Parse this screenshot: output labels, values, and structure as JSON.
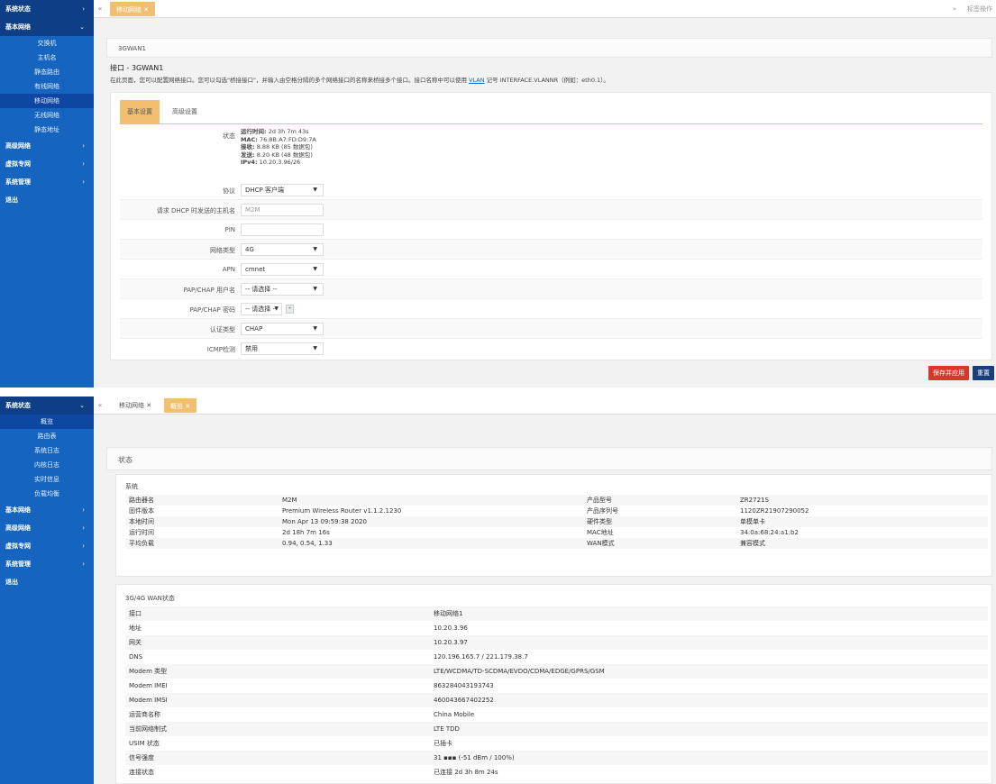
{
  "screen1": {
    "sidebar": {
      "groups": [
        "系统状态",
        "基本网络",
        "高级网络",
        "虚拟专网",
        "系统管理",
        "退出"
      ],
      "sub_items": [
        "交换机",
        "主机名",
        "静态路由",
        "有线网络",
        "移动网络",
        "无线网络",
        "静态地址"
      ]
    },
    "tabs": {
      "nav_left": "«",
      "active_tab": "移动网络",
      "nav_right": "»",
      "tab_ops": "标签操作"
    },
    "header": {
      "name": "3GWAN1",
      "title": "接口 - 3GWAN1",
      "desc_pre": "在此页面，您可以配置网络接口。您可以勾选\"桥接接口\"，并输入由空格分隔的多个网络接口的名称来桥接多个接口。接口名称中可以使用 ",
      "desc_link": "VLAN",
      "desc_post": " 记号 INTERFACE.VLANNR（例如：eth0.1）。"
    },
    "subtabs": [
      "基本设置",
      "高级设置"
    ],
    "status": {
      "label": "状态",
      "uptime_label": "运行时间:",
      "uptime": "2d 3h 7m 43s",
      "mac_label": "MAC:",
      "mac": "76:8B:A7:FD:D9:7A",
      "rx_label": "接收:",
      "rx": "8.88 KB (85 数据包)",
      "tx_label": "发送:",
      "tx": "8.20 KB (48 数据包)",
      "ipv4_label": "IPv4:",
      "ipv4": "10.20.3.96/26"
    },
    "fields": {
      "protocol": {
        "label": "协议",
        "value": "DHCP 客户端"
      },
      "hostname": {
        "label": "请求 DHCP 时发送的主机名",
        "placeholder": "M2M"
      },
      "pin": {
        "label": "PIN",
        "value": ""
      },
      "nettype": {
        "label": "网络类型",
        "value": "4G"
      },
      "apn": {
        "label": "APN",
        "value": "cmnet"
      },
      "user": {
        "label": "PAP/CHAP 用户名",
        "value": "-- 请选择 --"
      },
      "pass": {
        "label": "PAP/CHAP 密码",
        "value": "-- 请选择 --"
      },
      "auth": {
        "label": "认证类型",
        "value": "CHAP"
      },
      "icmp": {
        "label": "ICMP检测",
        "value": "禁用"
      }
    },
    "buttons": {
      "save": "保存并应用",
      "reset": "重置"
    },
    "colors": {
      "sidebar": "#1565c0",
      "tab_active": "#f0c070",
      "save": "#d9372c",
      "reset": "#1a3d7c"
    }
  },
  "screen2": {
    "sidebar": {
      "top": "系统状态",
      "sub_items": [
        "概览",
        "路由表",
        "系统日志",
        "内核日志",
        "实时信息",
        "负载均衡"
      ],
      "groups": [
        "基本网络",
        "高级网络",
        "虚拟专网",
        "系统管理",
        "退出"
      ]
    },
    "tabs": {
      "nav_left": "«",
      "tab1": "移动网络",
      "tab2": "概览"
    },
    "page_title": "状态",
    "system": {
      "title": "系统",
      "rows": [
        [
          "路由器名",
          "M2M",
          "产品型号",
          "ZR2721S"
        ],
        [
          "固件版本",
          "Premium Wireless Router v1.1.2.1230",
          "产品序列号",
          "1120ZR21907290052"
        ],
        [
          "本地时间",
          "Mon Apr 13 09:59:38 2020",
          "硬件类型",
          "单模单卡"
        ],
        [
          "运行时间",
          "2d 18h 7m 16s",
          "MAC地址",
          "34:0a:68:24:a1:b2"
        ],
        [
          "平均负载",
          "0.94, 0.54, 1.33",
          "WAN模式",
          "兼容模式"
        ]
      ]
    },
    "wan": {
      "title": "3G/4G WAN状态",
      "rows": [
        [
          "接口",
          "移动网络1"
        ],
        [
          "地址",
          "10.20.3.96"
        ],
        [
          "网关",
          "10.20.3.97"
        ],
        [
          "DNS",
          "120.196.165.7 / 221.179.38.7"
        ],
        [
          "Modem 类型",
          "LTE/WCDMA/TD-SCDMA/EVDO/CDMA/EDGE/GPRS/GSM"
        ],
        [
          "Modem IMEI",
          "863284043193743"
        ],
        [
          "Modem IMSI",
          "460043667402252"
        ],
        [
          "运营商名称",
          "China Mobile"
        ],
        [
          "当前网络制式",
          "LTE TDD"
        ],
        [
          "USIM 状态",
          "已插卡"
        ],
        [
          "信号强度",
          "31 ▪▪▪ (-51 dBm / 100%)"
        ],
        [
          "连接状态",
          "已连接 2d 3h 8m 24s"
        ]
      ]
    }
  }
}
